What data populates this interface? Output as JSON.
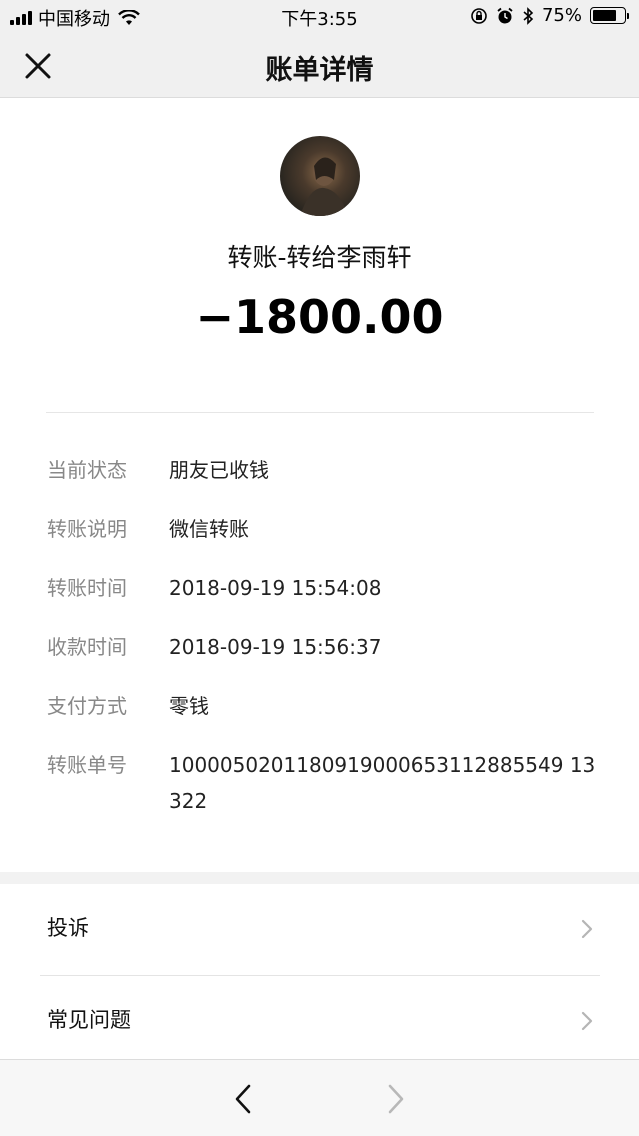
{
  "status_bar": {
    "carrier": "中国移动",
    "time": "下午3:55",
    "battery": "75%",
    "battery_level": 0.75
  },
  "nav": {
    "title": "账单详情"
  },
  "header": {
    "title": "转账-转给李雨轩",
    "amount": "−1800.00"
  },
  "details": [
    {
      "label": "当前状态",
      "value": "朋友已收钱"
    },
    {
      "label": "转账说明",
      "value": "微信转账"
    },
    {
      "label": "转账时间",
      "value": "2018-09-19 15:54:08"
    },
    {
      "label": "收款时间",
      "value": "2018-09-19 15:56:37"
    },
    {
      "label": "支付方式",
      "value": "零钱"
    },
    {
      "label": "转账单号",
      "value": "1000050201180919000653112885549 13322"
    }
  ],
  "actions": [
    {
      "label": "投诉"
    },
    {
      "label": "常见问题"
    }
  ]
}
